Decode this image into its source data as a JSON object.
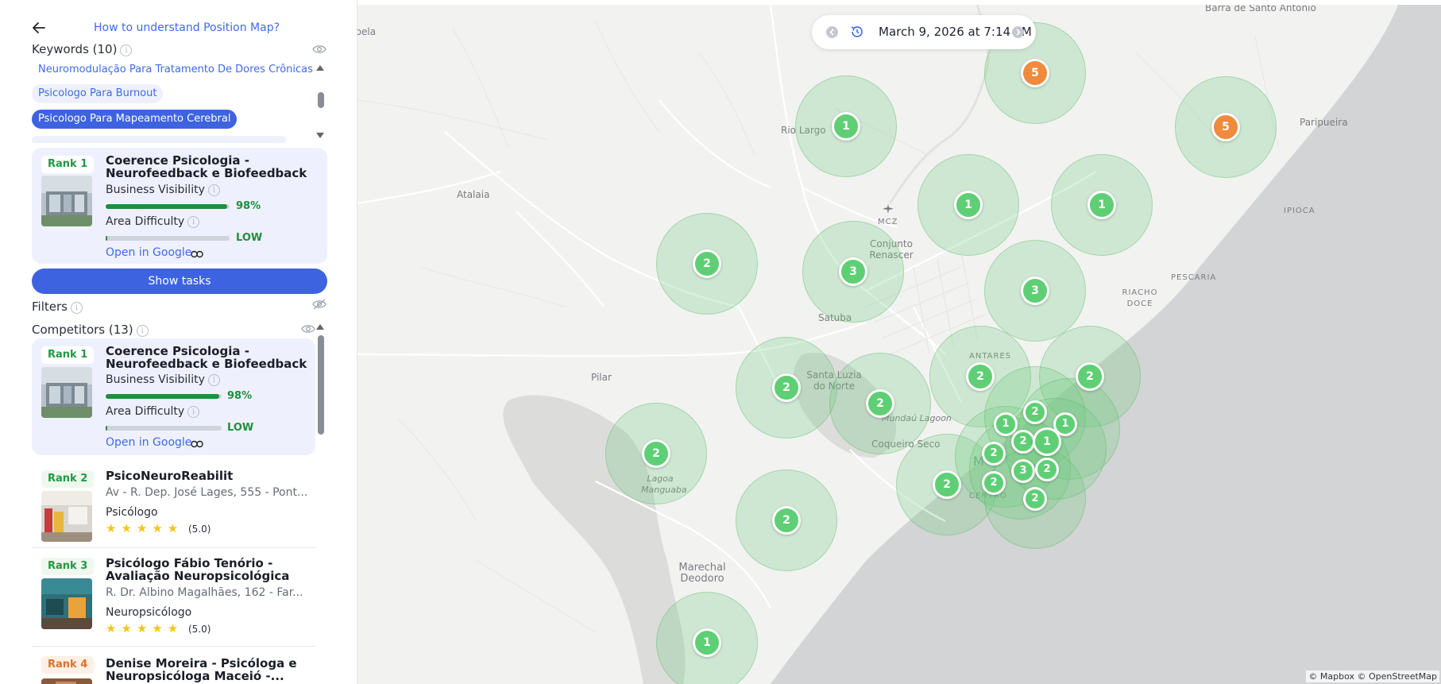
{
  "sidebar": {
    "help_link": "How to understand Position Map?",
    "keywords_title": "Keywords (10)",
    "keywords": [
      {
        "label": "Neuromodulação Para Tratamento De Dores Crônicas",
        "state": "top"
      },
      {
        "label": "Psicologo Para Burnout",
        "state": "plain"
      },
      {
        "label": "Psicologo Para Mapeamento Cerebral",
        "state": "active"
      }
    ],
    "selected_business": {
      "rank": "Rank 1",
      "name": "Coerence Psicologia - Neurofeedback e Biofeedback",
      "visibility_label": "Business Visibility",
      "visibility_value": "98%",
      "visibility_fraction": 0.98,
      "difficulty_label": "Area Difficulty",
      "difficulty_value": "LOW",
      "difficulty_fraction": 0.01,
      "open_link": "Open in Google"
    },
    "show_tasks": "Show tasks",
    "filters_title": "Filters",
    "competitors_title": "Competitors (13)",
    "competitors": [
      {
        "rank": "Rank 1",
        "name": "Coerence Psicologia - Neurofeedback e Biofeedback",
        "visibility_label": "Business Visibility",
        "visibility_value": "98%",
        "visibility_fraction": 0.98,
        "difficulty_label": "Area Difficulty",
        "difficulty_value": "LOW",
        "difficulty_fraction": 0.01,
        "open_link": "Open in Google"
      },
      {
        "rank": "Rank 2",
        "name": "PsicoNeuroReabilit",
        "address": "Av - R. Dep. José Lages, 555 - Pont...",
        "category": "Psicólogo",
        "stars": 5,
        "rating": "(5.0)"
      },
      {
        "rank": "Rank 3",
        "name": "Psicólogo Fábio Tenório - Avaliação Neuropsicológica",
        "address": "R. Dr. Albino Magalhães, 162 - Far...",
        "category": "Neuropsicólogo",
        "stars": 5,
        "rating": "(5.0)"
      },
      {
        "rank": "Rank 4",
        "name": "Denise Moreira - Psicóloga e Neuropsicóloga Maceió -..."
      }
    ]
  },
  "map": {
    "datetime": "March 9, 2026 at 7:14 PM",
    "attribution": "© Mapbox © OpenStreetMap",
    "places": [
      "Barra de Santo Antônio",
      "apela",
      "Rio Largo",
      "Atalaia",
      "MCZ",
      "Conjunto Renascer",
      "Satuba",
      "Paripueira",
      "IPIOCA",
      "PESCARIA",
      "RIACHO DOCE",
      "ANTARES",
      "Pilar",
      "Santa Luzia do Norte",
      "Mundaú Lagoon",
      "Coqueiro Seco",
      "Lagoa Manguaba",
      "Marechal Deodoro",
      "CENTRO",
      "M"
    ],
    "clusters": [
      {
        "label": "5",
        "color": "orange"
      },
      {
        "label": "5",
        "color": "orange"
      },
      {
        "label": "1",
        "color": "green"
      },
      {
        "label": "1",
        "color": "green"
      },
      {
        "label": "1",
        "color": "green"
      },
      {
        "label": "2",
        "color": "green"
      },
      {
        "label": "3",
        "color": "green"
      },
      {
        "label": "3",
        "color": "green"
      },
      {
        "label": "2",
        "color": "green"
      },
      {
        "label": "2",
        "color": "green"
      },
      {
        "label": "2",
        "color": "green"
      },
      {
        "label": "2",
        "color": "green"
      },
      {
        "label": "2",
        "color": "green"
      },
      {
        "label": "2",
        "color": "green"
      },
      {
        "label": "2",
        "color": "green"
      },
      {
        "label": "1",
        "color": "green"
      },
      {
        "label": "2",
        "color": "green"
      },
      {
        "label": "1",
        "color": "green"
      },
      {
        "label": "2",
        "color": "green"
      },
      {
        "label": "2",
        "color": "green"
      },
      {
        "label": "3",
        "color": "green"
      },
      {
        "label": "1",
        "color": "green"
      },
      {
        "label": "2",
        "color": "green"
      },
      {
        "label": "2",
        "color": "green"
      },
      {
        "label": "2",
        "color": "green"
      },
      {
        "label": "1",
        "color": "green"
      }
    ]
  },
  "colors": {
    "accent": "#3d63e0",
    "visibility_bar": "#1f8e3d",
    "cluster_green": "#5fcf75",
    "cluster_orange": "#f08a3c",
    "link": "#3f6ae8"
  }
}
